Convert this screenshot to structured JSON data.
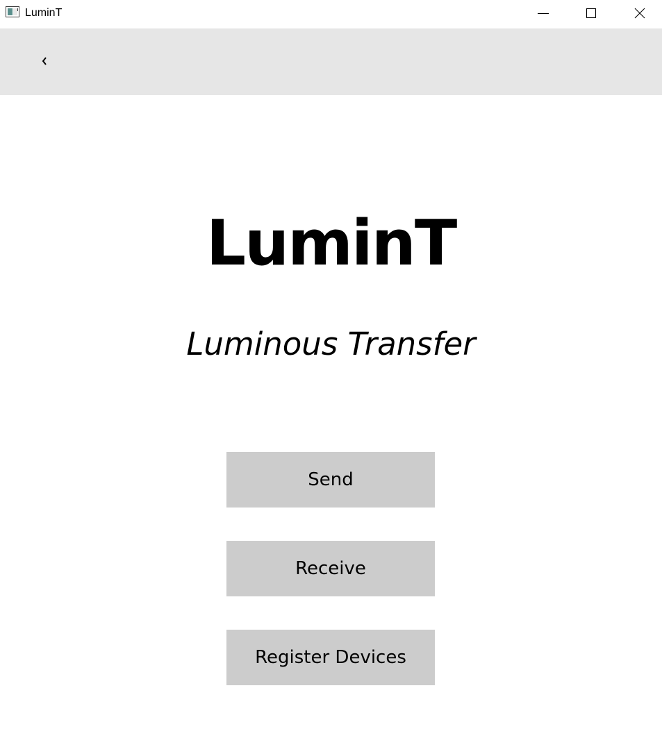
{
  "window": {
    "title": "LuminT",
    "controls": {
      "minimize_icon": "minimize-icon",
      "maximize_icon": "maximize-icon",
      "close_icon": "close-icon"
    }
  },
  "navbar": {
    "back_label": "‹"
  },
  "main": {
    "title": "LuminT",
    "subtitle": "Luminous Transfer",
    "buttons": [
      {
        "label": "Send"
      },
      {
        "label": "Receive"
      },
      {
        "label": "Register Devices"
      }
    ]
  },
  "colors": {
    "navbar_bg": "#e6e6e6",
    "button_bg": "#cccccc",
    "background": "#ffffff",
    "text": "#000000"
  }
}
